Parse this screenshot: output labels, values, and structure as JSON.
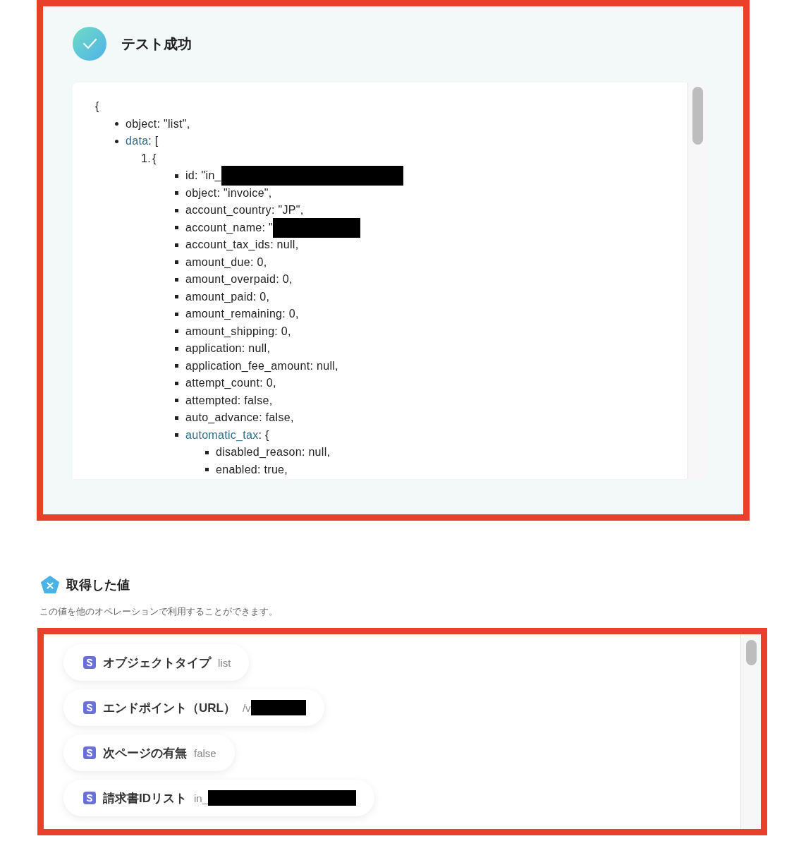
{
  "result": {
    "title": "テスト成功",
    "code": [
      {
        "text": "{",
        "children": [
          {
            "kind": "disc",
            "text": "object: \"list\","
          },
          {
            "kind": "disc",
            "key": "data",
            "text": ": [",
            "children": [
              {
                "kind": "numbered",
                "number": "1.",
                "text": "{",
                "children": [
                  {
                    "kind": "square",
                    "text": "id: \"in_",
                    "redacted": true
                  },
                  {
                    "kind": "square",
                    "text": "object: \"invoice\","
                  },
                  {
                    "kind": "square",
                    "text": "account_country: \"JP\","
                  },
                  {
                    "kind": "square",
                    "text": "account_name: \"",
                    "redacted": true
                  },
                  {
                    "kind": "square",
                    "text": "account_tax_ids: null,"
                  },
                  {
                    "kind": "square",
                    "text": "amount_due: 0,"
                  },
                  {
                    "kind": "square",
                    "text": "amount_overpaid: 0,"
                  },
                  {
                    "kind": "square",
                    "text": "amount_paid: 0,"
                  },
                  {
                    "kind": "square",
                    "text": "amount_remaining: 0,"
                  },
                  {
                    "kind": "square",
                    "text": "amount_shipping: 0,"
                  },
                  {
                    "kind": "square",
                    "text": "application: null,"
                  },
                  {
                    "kind": "square",
                    "text": "application_fee_amount: null,"
                  },
                  {
                    "kind": "square",
                    "text": "attempt_count: 0,"
                  },
                  {
                    "kind": "square",
                    "text": "attempted: false,"
                  },
                  {
                    "kind": "square",
                    "text": "auto_advance: false,"
                  },
                  {
                    "kind": "square",
                    "key": "automatic_tax",
                    "text": ": {",
                    "children": [
                      {
                        "kind": "square",
                        "text": "disabled_reason: null,"
                      },
                      {
                        "kind": "square",
                        "text": "enabled: true,"
                      }
                    ]
                  }
                ]
              }
            ]
          }
        ]
      }
    ]
  },
  "values": {
    "title": "取得した値",
    "description": "この値を他のオペレーションで利用することができます。",
    "items": [
      {
        "label": "オブジェクトタイプ",
        "value": "list"
      },
      {
        "label": "エンドポイント（URL）",
        "value": "/v",
        "redacted": true
      },
      {
        "label": "次ページの有無",
        "value": "false"
      },
      {
        "label": "請求書IDリスト",
        "value": "in_",
        "redacted": true
      }
    ]
  }
}
